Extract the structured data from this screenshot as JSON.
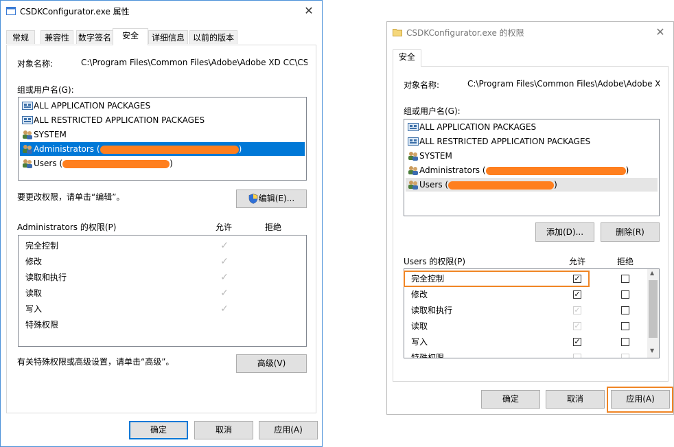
{
  "left": {
    "title": "CSDKConfigurator.exe 属性",
    "close_glyph": "✕",
    "tabs": [
      "常规",
      "兼容性",
      "数字签名",
      "安全",
      "详细信息",
      "以前的版本"
    ],
    "object_label": "对象名称:",
    "object_value": "C:\\Program Files\\Common Files\\Adobe\\Adobe XD CC\\CS",
    "group_label": "组或用户名(G):",
    "users": [
      {
        "name": "ALL APPLICATION PACKAGES",
        "icon": "packages-icon"
      },
      {
        "name": "ALL RESTRICTED APPLICATION PACKAGES",
        "icon": "packages-icon"
      },
      {
        "name": "SYSTEM",
        "icon": "users-group-icon"
      },
      {
        "name": "Administrators (",
        "suffix": ")",
        "icon": "users-group-icon",
        "selected": true
      },
      {
        "name": "Users (",
        "suffix": ")",
        "icon": "users-group-icon"
      }
    ],
    "change_hint": "要更改权限，请单击“编辑”。",
    "edit_button": "编辑(E)...",
    "perm_label": "Administrators 的权限(P)",
    "allow_header": "允许",
    "deny_header": "拒绝",
    "permissions": [
      "完全控制",
      "修改",
      "读取和执行",
      "读取",
      "写入",
      "特殊权限"
    ],
    "allowed": [
      true,
      true,
      true,
      true,
      true,
      false
    ],
    "check_glyph": "✓",
    "advanced_hint": "有关特殊权限或高级设置，请单击“高级”。",
    "advanced_button": "高级(V)",
    "ok": "确定",
    "cancel": "取消",
    "apply": "应用(A)"
  },
  "right": {
    "title": "CSDKConfigurator.exe 的权限",
    "close_glyph": "✕",
    "tab": "安全",
    "object_label": "对象名称:",
    "object_value": "C:\\Program Files\\Common Files\\Adobe\\Adobe X",
    "group_label": "组或用户名(G):",
    "users": [
      {
        "name": "ALL APPLICATION PACKAGES",
        "icon": "packages-icon"
      },
      {
        "name": "ALL RESTRICTED APPLICATION PACKAGES",
        "icon": "packages-icon"
      },
      {
        "name": "SYSTEM",
        "icon": "users-group-icon"
      },
      {
        "name": "Administrators (",
        "suffix": ")",
        "icon": "users-group-icon"
      },
      {
        "name": "Users (",
        "suffix": ")",
        "icon": "users-group-icon",
        "hover": true
      }
    ],
    "add_button": "添加(D)...",
    "remove_button": "删除(R)",
    "perm_label": "Users 的权限(P)",
    "allow_header": "允许",
    "deny_header": "拒绝",
    "permissions": [
      "完全控制",
      "修改",
      "读取和执行",
      "读取",
      "写入",
      "特殊权限"
    ],
    "allow_state": [
      "checked",
      "checked",
      "disabled-checked",
      "disabled-checked",
      "checked",
      "disabled"
    ],
    "deny_state": [
      "unchecked",
      "unchecked",
      "unchecked",
      "unchecked",
      "unchecked",
      "disabled"
    ],
    "check_glyph": "✓",
    "scroll_up_glyph": "▲",
    "scroll_down_glyph": "▼",
    "ok": "确定",
    "cancel": "取消",
    "apply": "应用(A)",
    "highlight_color": "#f08524"
  },
  "colors": {
    "selection": "#0078d7",
    "redaction": "#ff7f1e",
    "window_border": "#4a90d9"
  }
}
